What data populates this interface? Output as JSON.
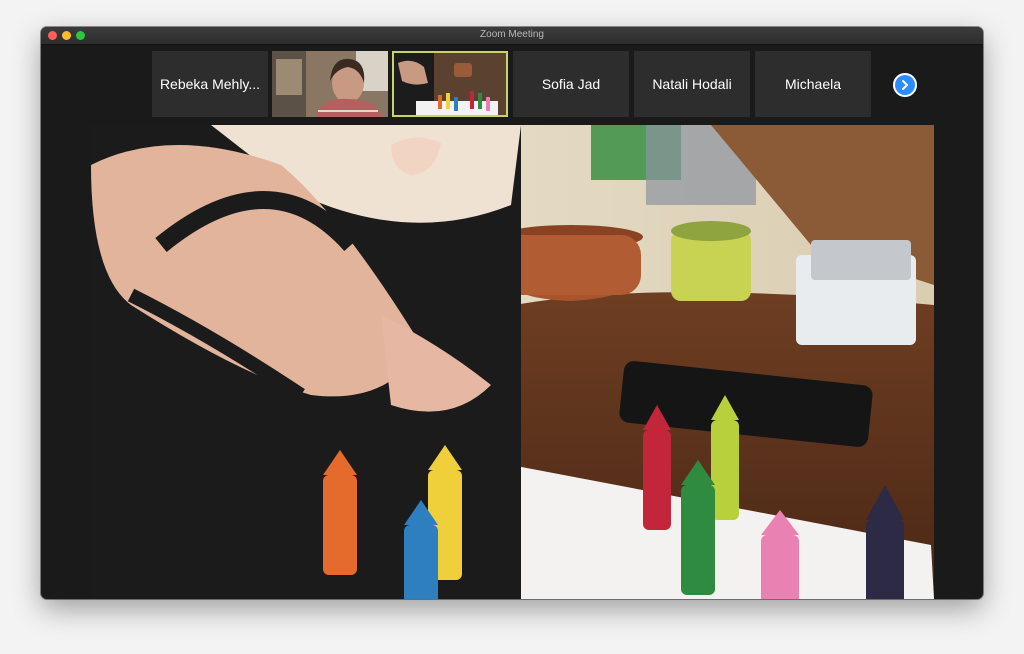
{
  "window": {
    "title": "Zoom Meeting"
  },
  "participants": [
    {
      "name": "Rebeka Mehly..."
    },
    {
      "name": "Sofia Jad"
    },
    {
      "name": "Natali Hodali"
    },
    {
      "name": "Michaela"
    }
  ],
  "icons": {
    "close": "traffic-light-red",
    "minimize": "traffic-light-yellow",
    "maximize": "traffic-light-green",
    "next": "chevron-right-icon"
  },
  "colors": {
    "window_bg": "#1a1a1a",
    "tile_bg": "#2d2d2d",
    "active_speaker_border": "#c7d36b",
    "accent_blue": "#2d8cff"
  }
}
